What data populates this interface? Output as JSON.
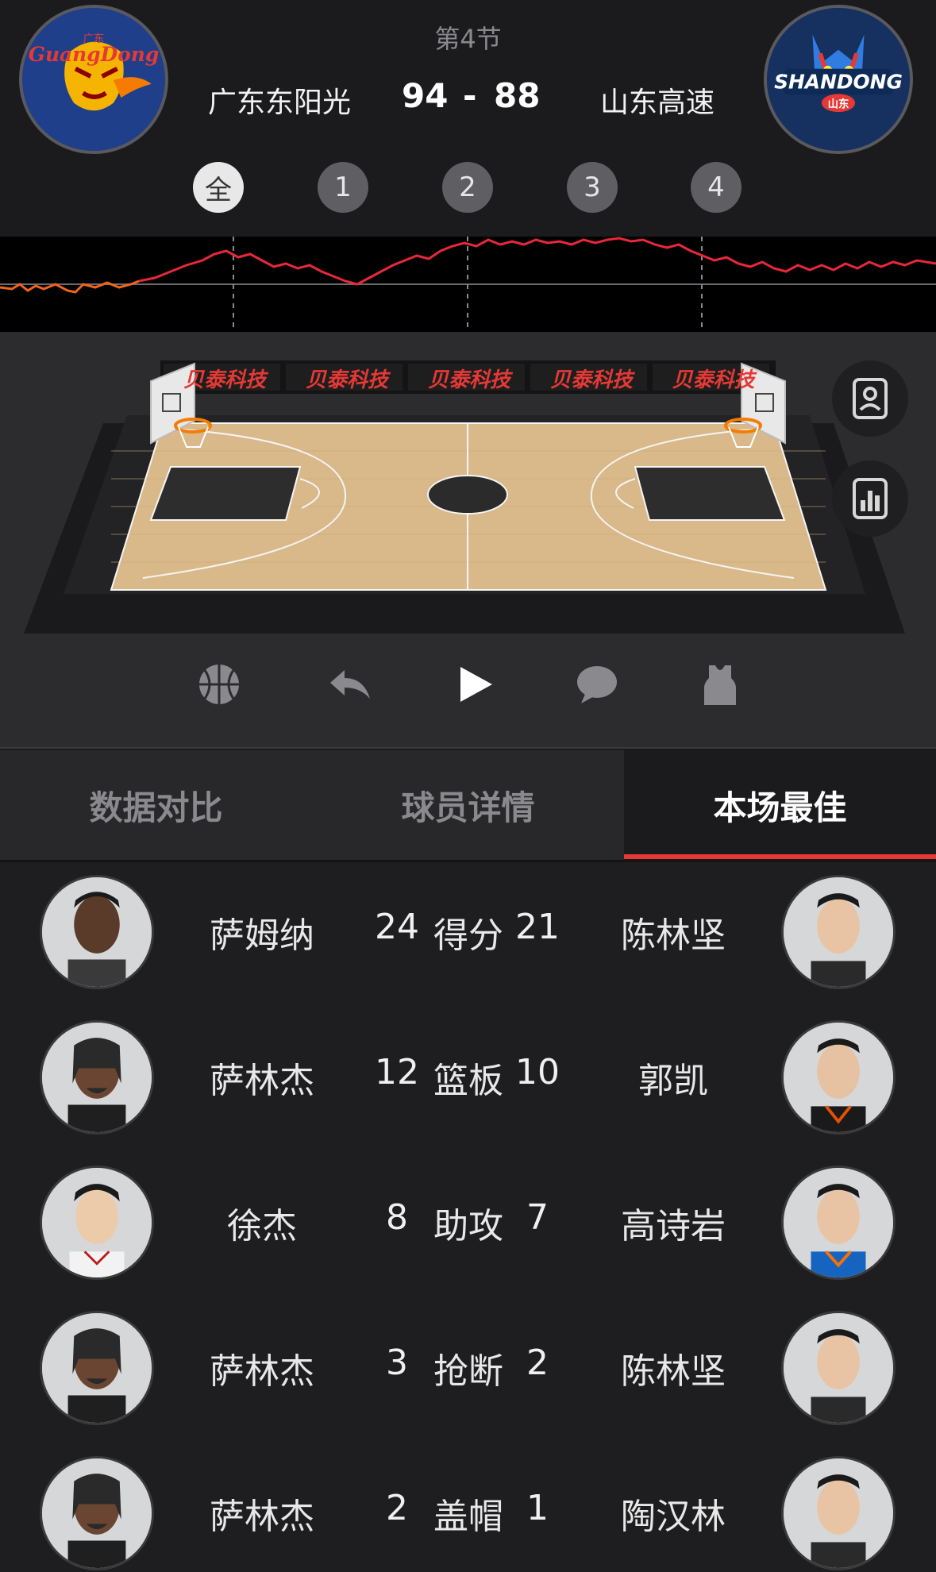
{
  "header": {
    "period": "第4节",
    "home_team": "广东东阳光",
    "away_team": "山东高速",
    "home_score": "94",
    "dash": "-",
    "away_score": "88",
    "home_logo_text": "GuangDong",
    "home_logo_small": "广东",
    "away_logo_text": "SHANDONG",
    "away_logo_small": "山东"
  },
  "quarters": [
    "全",
    "1",
    "2",
    "3",
    "4"
  ],
  "sponsor": "贝泰科技",
  "tabs": [
    "数据对比",
    "球员详情",
    "本场最佳"
  ],
  "active_tab": "本场最佳",
  "best": [
    {
      "home_player": "萨姆纳",
      "home_value": "24",
      "category": "得分",
      "away_value": "21",
      "away_player": "陈林坚"
    },
    {
      "home_player": "萨林杰",
      "home_value": "12",
      "category": "篮板",
      "away_value": "10",
      "away_player": "郭凯"
    },
    {
      "home_player": "徐杰",
      "home_value": "8",
      "category": "助攻",
      "away_value": "7",
      "away_player": "高诗岩"
    },
    {
      "home_player": "萨林杰",
      "home_value": "3",
      "category": "抢断",
      "away_value": "2",
      "away_player": "陈林坚"
    },
    {
      "home_player": "萨林杰",
      "home_value": "2",
      "category": "盖帽",
      "away_value": "1",
      "away_player": "陶汉林"
    }
  ],
  "colors": {
    "accent": "#e53935",
    "trend_line": "#e8283a",
    "background": "#1a1a1c"
  },
  "icons": [
    "basketball-icon",
    "undo-icon",
    "play-icon",
    "comment-icon",
    "jersey-icon",
    "player-card-icon",
    "stats-chart-icon"
  ]
}
